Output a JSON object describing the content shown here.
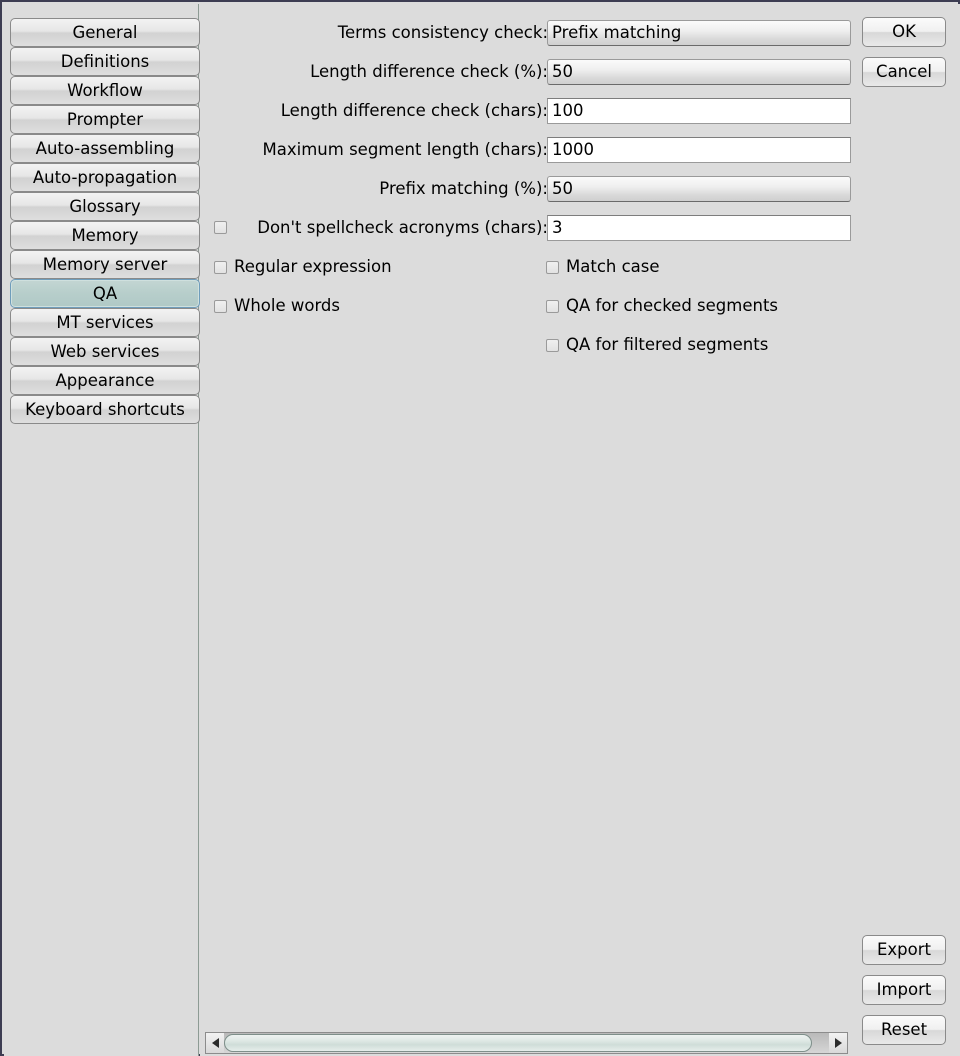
{
  "sidebar": {
    "items": [
      {
        "label": "General",
        "selected": false
      },
      {
        "label": "Definitions",
        "selected": false
      },
      {
        "label": "Workflow",
        "selected": false
      },
      {
        "label": "Prompter",
        "selected": false
      },
      {
        "label": "Auto-assembling",
        "selected": false
      },
      {
        "label": "Auto-propagation",
        "selected": false
      },
      {
        "label": "Glossary",
        "selected": false
      },
      {
        "label": "Memory",
        "selected": false
      },
      {
        "label": "Memory server",
        "selected": false
      },
      {
        "label": "QA",
        "selected": true
      },
      {
        "label": "MT services",
        "selected": false
      },
      {
        "label": "Web services",
        "selected": false
      },
      {
        "label": "Appearance",
        "selected": false
      },
      {
        "label": "Keyboard shortcuts",
        "selected": false
      }
    ]
  },
  "form": {
    "rows": [
      {
        "label": "Terms consistency check:",
        "value": "Prefix matching",
        "enabled": false,
        "has_checkbox": false
      },
      {
        "label": "Length difference check (%):",
        "value": "50",
        "enabled": false,
        "has_checkbox": false
      },
      {
        "label": "Length difference check (chars):",
        "value": "100",
        "enabled": true,
        "has_checkbox": false
      },
      {
        "label": "Maximum segment length (chars):",
        "value": "1000",
        "enabled": true,
        "has_checkbox": false
      },
      {
        "label": "Prefix matching (%):",
        "value": "50",
        "enabled": false,
        "has_checkbox": false
      },
      {
        "label": "Don't spellcheck acronyms (chars):",
        "value": "3",
        "enabled": true,
        "has_checkbox": true,
        "checked": false
      }
    ]
  },
  "checkboxes": {
    "left_column": [
      {
        "label": "Regular expression",
        "checked": false
      },
      {
        "label": "Whole words",
        "checked": false
      }
    ],
    "right_column": [
      {
        "label": "Match case",
        "checked": false
      },
      {
        "label": "QA for checked segments",
        "checked": false
      },
      {
        "label": "QA for filtered segments",
        "checked": false
      }
    ]
  },
  "buttons": {
    "top": [
      {
        "label": "OK",
        "name": "ok-button"
      },
      {
        "label": "Cancel",
        "name": "cancel-button"
      }
    ],
    "bottom": [
      {
        "label": "Export",
        "name": "export-button"
      },
      {
        "label": "Import",
        "name": "import-button"
      },
      {
        "label": "Reset",
        "name": "reset-button"
      }
    ]
  },
  "scrollbar": {
    "left_arrow_icon": "triangle-left-icon",
    "right_arrow_icon": "triangle-right-icon",
    "thumb_fraction": 0.95
  },
  "colors": {
    "background": "#dcdcdc",
    "selected_tab": "#b7cecb",
    "selected_tab_border": "#6f9dbb",
    "window_border": "#3d3d52",
    "scrollbar_thumb": "#dfe9e5"
  }
}
